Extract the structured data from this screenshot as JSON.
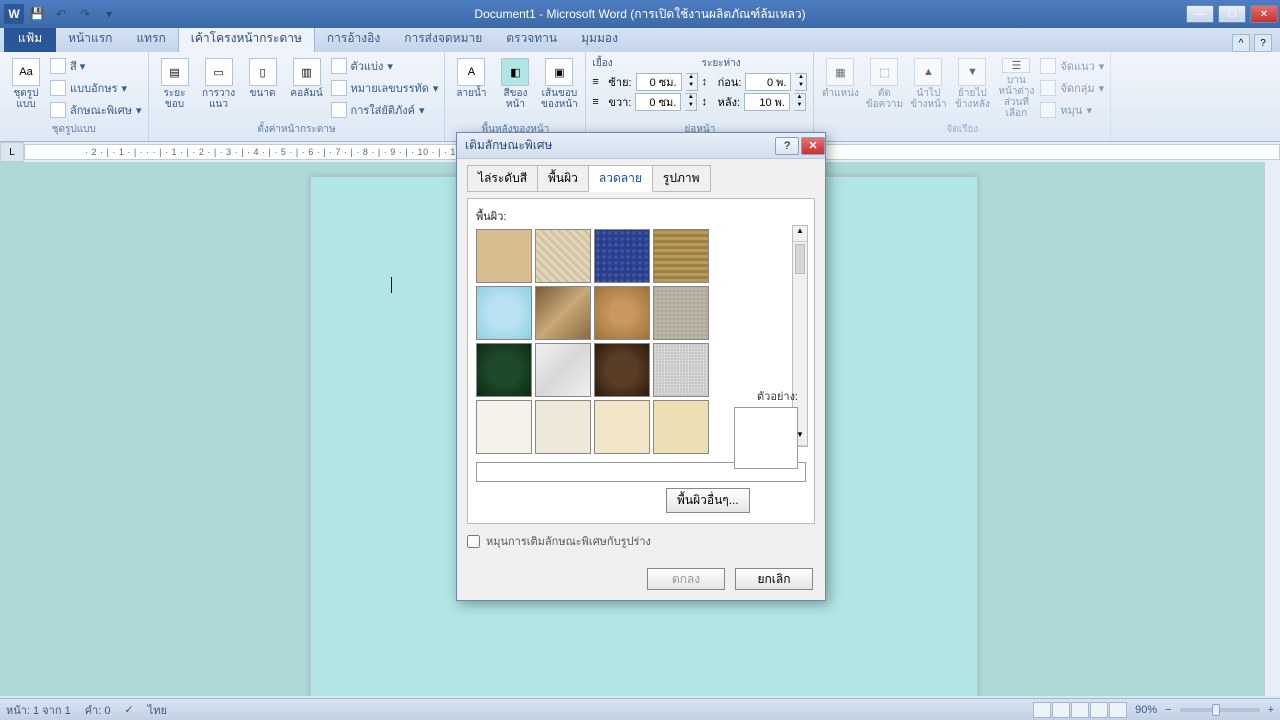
{
  "app": {
    "title": "Document1 - Microsoft Word (การเปิดใช้งานผลิตภัณฑ์ล้มเหลว)",
    "qat_word": "W"
  },
  "ribbon": {
    "file_tab": "แฟ้ม",
    "tabs": [
      "หน้าแรก",
      "แทรก",
      "เค้าโครงหน้ากระดาษ",
      "การอ้างอิง",
      "การส่งจดหมาย",
      "ตรวจทาน",
      "มุมมอง"
    ],
    "active_tab_index": 2,
    "groups": {
      "themes": {
        "label": "ชุดรูปแบบ",
        "btn_theme": "ชุดรูปแบบ",
        "font_small": "แบบอักษร",
        "effects_small": "ลักษณะพิเศษ"
      },
      "page_setup": {
        "label": "ตั้งค่าหน้ากระดาษ",
        "margins": "ระยะขอบ",
        "orientation": "การวางแนว",
        "size": "ขนาด",
        "columns": "คอลัมน์",
        "breaks": "ตัวแบ่ง",
        "line_numbers": "หมายเลขบรรทัด",
        "hyphenation": "การใส่ยัติภังค์"
      },
      "page_bg": {
        "watermark": "ลายน้ำ",
        "page_color": "สีของหน้า",
        "page_border": "เส้นขอบของหน้า"
      },
      "paragraph": {
        "label_indent": "เยื้อง",
        "label_spacing": "ระยะห่าง",
        "left": "ซ้าย:",
        "right": "ขวา:",
        "before": "ก่อน:",
        "after": "หลัง:",
        "val_zero_cm": "0 ซม.",
        "val_zero_pt": "0 พ.",
        "val_ten_pt": "10 พ."
      },
      "arrange": {
        "position": "ตำแหน่ง",
        "wrap": "ตัดข้อความ",
        "bring": "นำไปข้างหน้า",
        "send": "ย้ายไปข้างหลัง",
        "pane": "บานหน้าต่างส่วนที่เลือก",
        "align": "จัดแนว",
        "group": "จัดกลุ่ม",
        "rotate": "หมุน"
      }
    }
  },
  "ruler_text": "· 2 · | · 1 · | · · · | · 1 · | · 2 · | · 3 · | · 4 · | · 5 · | · 6 · | · 7 · | · 8 · | · 9 · | · 10 · | · 11 · | · 12 · | · 13 · | · 14 · | · 15 · | · · · | · 17 · | · 18 ·",
  "dialog": {
    "title": "เติมลักษณะพิเศษ",
    "tabs": [
      "ไล่ระดับสี",
      "พื้นผิว",
      "ลวดลาย",
      "รูปภาพ"
    ],
    "active_tab_index": 2,
    "section_label": "พื้นผิว:",
    "other_texture": "พื้นผิวอื่นๆ...",
    "preview_label": "ตัวอย่าง:",
    "rotate_label": "หมุนการเติมลักษณะพิเศษกับรูปร่าง",
    "ok": "ตกลง",
    "cancel": "ยกเลิก"
  },
  "statusbar": {
    "page": "หน้า: 1 จาก 1",
    "words": "คำ: 0",
    "lang": "ไทย",
    "zoom": "90%"
  }
}
